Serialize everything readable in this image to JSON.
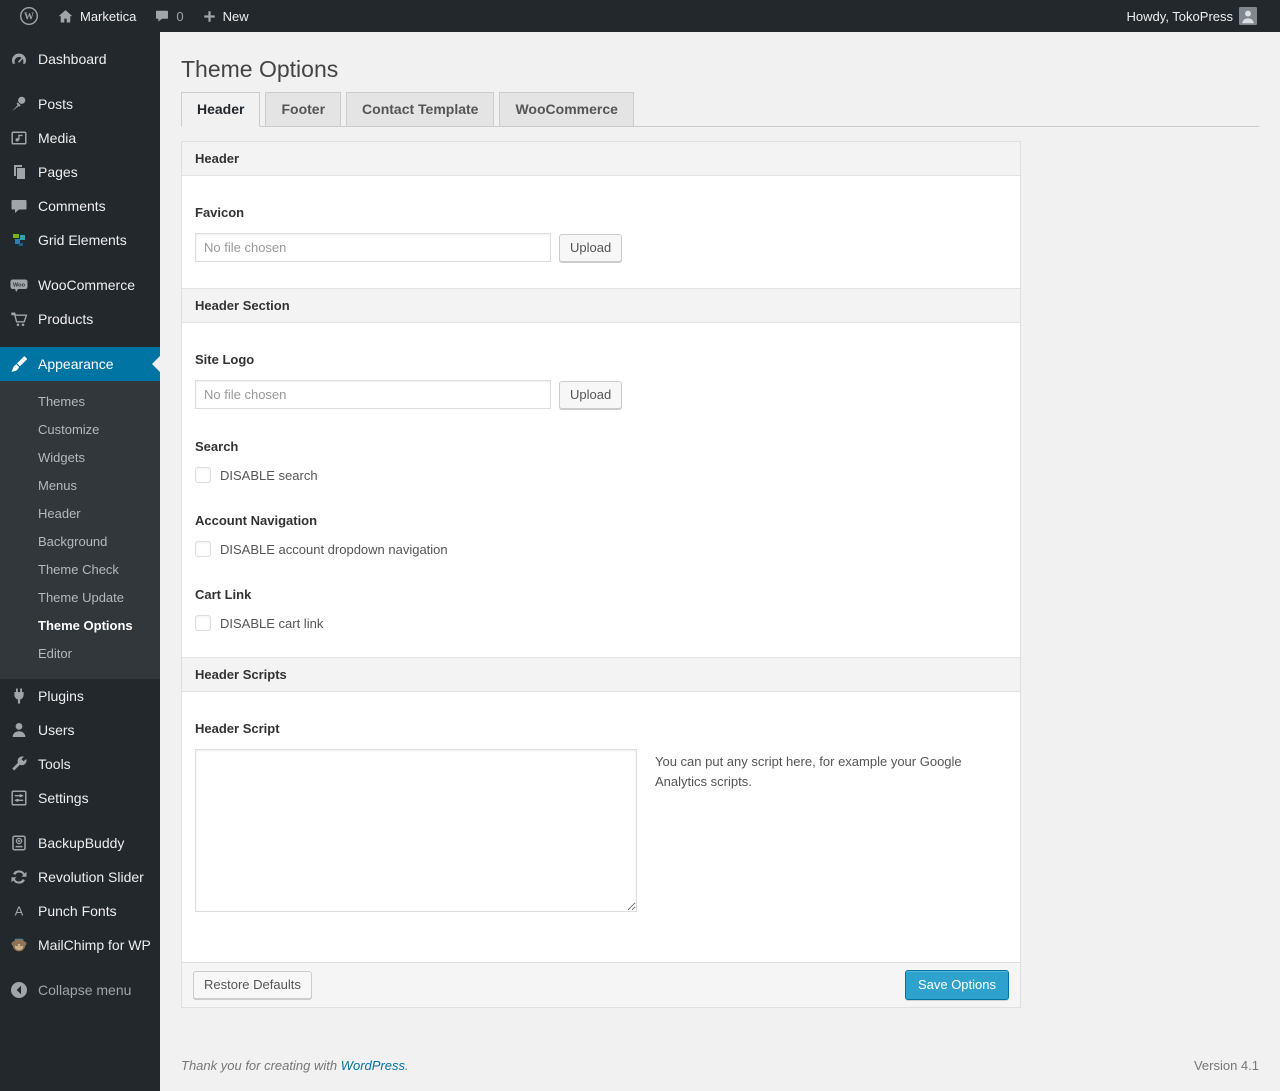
{
  "admin_bar": {
    "site_name": "Marketica",
    "comment_count": "0",
    "new_label": "New",
    "howdy": "Howdy, TokoPress"
  },
  "sidebar": {
    "items": [
      {
        "id": "dashboard",
        "label": "Dashboard"
      },
      {
        "id": "posts",
        "label": "Posts"
      },
      {
        "id": "media",
        "label": "Media"
      },
      {
        "id": "pages",
        "label": "Pages"
      },
      {
        "id": "comments",
        "label": "Comments"
      },
      {
        "id": "grid-elements",
        "label": "Grid Elements"
      },
      {
        "id": "woocommerce",
        "label": "WooCommerce"
      },
      {
        "id": "products",
        "label": "Products"
      },
      {
        "id": "appearance",
        "label": "Appearance"
      },
      {
        "id": "plugins",
        "label": "Plugins"
      },
      {
        "id": "users",
        "label": "Users"
      },
      {
        "id": "tools",
        "label": "Tools"
      },
      {
        "id": "settings",
        "label": "Settings"
      },
      {
        "id": "backupbuddy",
        "label": "BackupBuddy"
      },
      {
        "id": "revolution-slider",
        "label": "Revolution Slider"
      },
      {
        "id": "punch-fonts",
        "label": "Punch Fonts"
      },
      {
        "id": "mailchimp",
        "label": "MailChimp for WP"
      }
    ],
    "appearance_submenu": [
      "Themes",
      "Customize",
      "Widgets",
      "Menus",
      "Header",
      "Background",
      "Theme Check",
      "Theme Update",
      "Theme Options",
      "Editor"
    ],
    "active_item": "Appearance",
    "active_submenu": "Theme Options",
    "collapse_label": "Collapse menu"
  },
  "page": {
    "title": "Theme Options",
    "tabs": [
      {
        "label": "Header",
        "active": true
      },
      {
        "label": "Footer",
        "active": false
      },
      {
        "label": "Contact Template",
        "active": false
      },
      {
        "label": "WooCommerce",
        "active": false
      }
    ]
  },
  "panel": {
    "sections": {
      "header": {
        "title": "Header",
        "favicon": {
          "label": "Favicon",
          "placeholder": "No file chosen",
          "button": "Upload"
        }
      },
      "header_section": {
        "title": "Header Section",
        "site_logo": {
          "label": "Site Logo",
          "placeholder": "No file chosen",
          "button": "Upload"
        },
        "search": {
          "label": "Search",
          "checkbox": "DISABLE search",
          "checked": false
        },
        "account_navigation": {
          "label": "Account Navigation",
          "checkbox": "DISABLE account dropdown navigation",
          "checked": false
        },
        "cart_link": {
          "label": "Cart Link",
          "checkbox": "DISABLE cart link",
          "checked": false
        }
      },
      "header_scripts": {
        "title": "Header Scripts",
        "header_script": {
          "label": "Header Script",
          "value": "",
          "help": "You can put any script here, for example your Google Analytics scripts."
        }
      }
    },
    "footer": {
      "restore_button": "Restore Defaults",
      "save_button": "Save Options"
    }
  },
  "page_footer": {
    "thanks_text": "Thank you for creating with",
    "link_text": "WordPress",
    "suffix": ".",
    "version": "Version 4.1"
  },
  "colors": {
    "admin_bar_bg": "#23282d",
    "menu_bg": "#23282d",
    "submenu_bg": "#32373c",
    "active_menu_bg": "#0074a2",
    "body_bg": "#f1f1f1",
    "primary_button_bg": "#2ea2cc",
    "primary_button_border": "#0074a2",
    "link": "#0074a2",
    "icon_gray": "#a0a5aa"
  },
  "icons": {
    "wordpress-logo-icon": "W in a circle",
    "home-icon": "house",
    "comments-bubble-icon": "speech bubble with count",
    "plus-icon": "plus sign",
    "avatar": "gray person silhouette",
    "dashboard-icon": "gauge",
    "posts-icon": "pushpin",
    "media-icon": "frame with music note",
    "pages-icon": "stacked pages",
    "comments-icon": "speech bubble",
    "grid-elements-icon": "colored grid tiles",
    "woocommerce-icon": "Woo badge",
    "products-icon": "shopping cart",
    "appearance-icon": "paint brush",
    "plugins-icon": "power plug",
    "users-icon": "person",
    "tools-icon": "wrench",
    "settings-icon": "slider controls",
    "backupbuddy-icon": "backup box with plus",
    "revolution-slider-icon": "circular refresh arrows",
    "punch-fonts-icon": "letter A",
    "mailchimp-icon": "monkey face",
    "collapse-icon": "circled left arrow"
  }
}
